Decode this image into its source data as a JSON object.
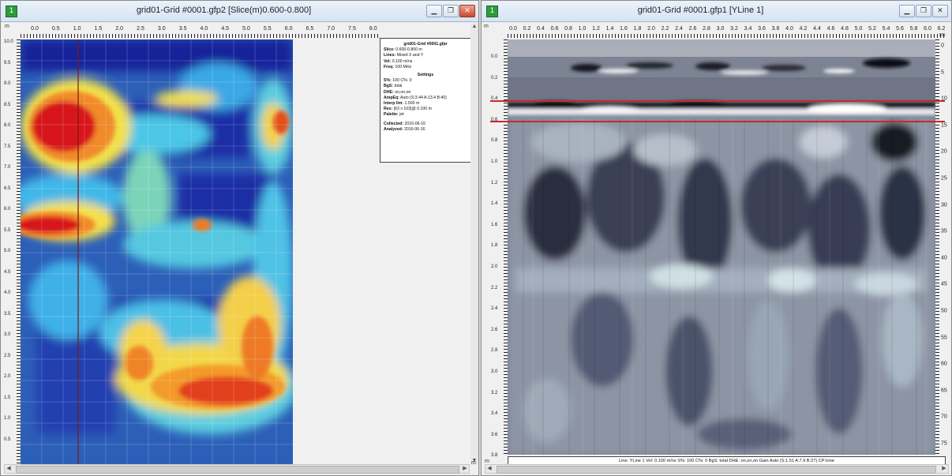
{
  "left_window": {
    "title": "grid01-Grid #0001.gfp2 [Slice(m)0.600-0.800]",
    "icon": "app-icon",
    "top_ruler_labels": [
      "0.0",
      "0.5",
      "1.0",
      "1.5",
      "2.0",
      "2.5",
      "3.0",
      "3.5",
      "4.0",
      "4.5",
      "5.0",
      "5.5",
      "6.0",
      "6.5",
      "7.0",
      "7.5",
      "8.0"
    ],
    "left_ruler_labels": [
      "10.0",
      "9.5",
      "9.0",
      "8.5",
      "8.0",
      "7.5",
      "7.0",
      "6.5",
      "6.0",
      "5.5",
      "5.0",
      "4.5",
      "4.0",
      "3.5",
      "3.0",
      "2.5",
      "2.0",
      "1.5",
      "1.0",
      "0.5"
    ],
    "corner_label_top": "m",
    "corner_label_bottom": "m",
    "info": {
      "header": "grid01-Grid #0001.gfpr",
      "lines": [
        {
          "k": "Slice:",
          "v": "0.600-0.800 m"
        },
        {
          "k": "Lines:",
          "v": "Mixed X and Y"
        },
        {
          "k": "Vel:",
          "v": "0.100 m/ns"
        },
        {
          "k": "Freq:",
          "v": "100 MHz"
        }
      ],
      "settings_header": "Settings",
      "settings": [
        {
          "k": "S%:",
          "v": "100  C%: 0"
        },
        {
          "k": "BgS:",
          "v": "total"
        },
        {
          "k": "DHE:",
          "v": "on,on,on"
        },
        {
          "k": "AmpEq:",
          "v": "Auto (S:3.44 A:13.4 B:40)"
        },
        {
          "k": "Interp lim:",
          "v": "1.500 m"
        },
        {
          "k": "Res:",
          "v": "[63 x 103]@ 0.100 m"
        },
        {
          "k": "Palette:",
          "v": "jet"
        }
      ],
      "dates": [
        {
          "k": "Collected:",
          "v": "2016-06-16"
        },
        {
          "k": "Analyzed:",
          "v": "2016-06-16"
        }
      ]
    }
  },
  "right_window": {
    "title": "grid01-Grid #0001.gfp1 [YLine 1]",
    "icon": "app-icon",
    "top_ruler_labels": [
      "0.0",
      "0.2",
      "0.4",
      "0.6",
      "0.8",
      "1.0",
      "1.2",
      "1.4",
      "1.6",
      "1.8",
      "2.0",
      "2.2",
      "2.4",
      "2.6",
      "2.8",
      "3.0",
      "3.2",
      "3.4",
      "3.6",
      "3.8",
      "4.0",
      "4.2",
      "4.4",
      "4.6",
      "4.8",
      "5.0",
      "5.2",
      "5.4",
      "5.6",
      "5.8",
      "6.0",
      "6.2"
    ],
    "left_ruler_labels": [
      "0.0",
      "0.2",
      "0.4",
      "0.6",
      "0.8",
      "1.0",
      "1.2",
      "1.4",
      "1.6",
      "1.8",
      "2.0",
      "2.2",
      "2.4",
      "2.6",
      "2.8",
      "3.0",
      "3.2",
      "3.4",
      "3.6",
      "3.8"
    ],
    "right_ruler_labels": [
      "0",
      "5",
      "10",
      "15",
      "20",
      "25",
      "30",
      "35",
      "40",
      "45",
      "50",
      "55",
      "60",
      "65",
      "70",
      "75"
    ],
    "corner_label_top": "m",
    "corner_label_bottom": "m",
    "corner_label_right": "ns",
    "status": "Line: YLine 1  Vel: 0.100 m/ns  S%: 100  C%: 0  BgS: total  DHE: on,on,on  Gain Auto (S:1.51 A:7.9 B:27)  CP:tone",
    "slice_depth_m": [
      0.6,
      0.8
    ]
  },
  "colors": {
    "titlebar": "#dbe7f5",
    "redline": "#c8282a",
    "jet_high": "#d7191c",
    "jet_low": "#1f3aa6"
  }
}
